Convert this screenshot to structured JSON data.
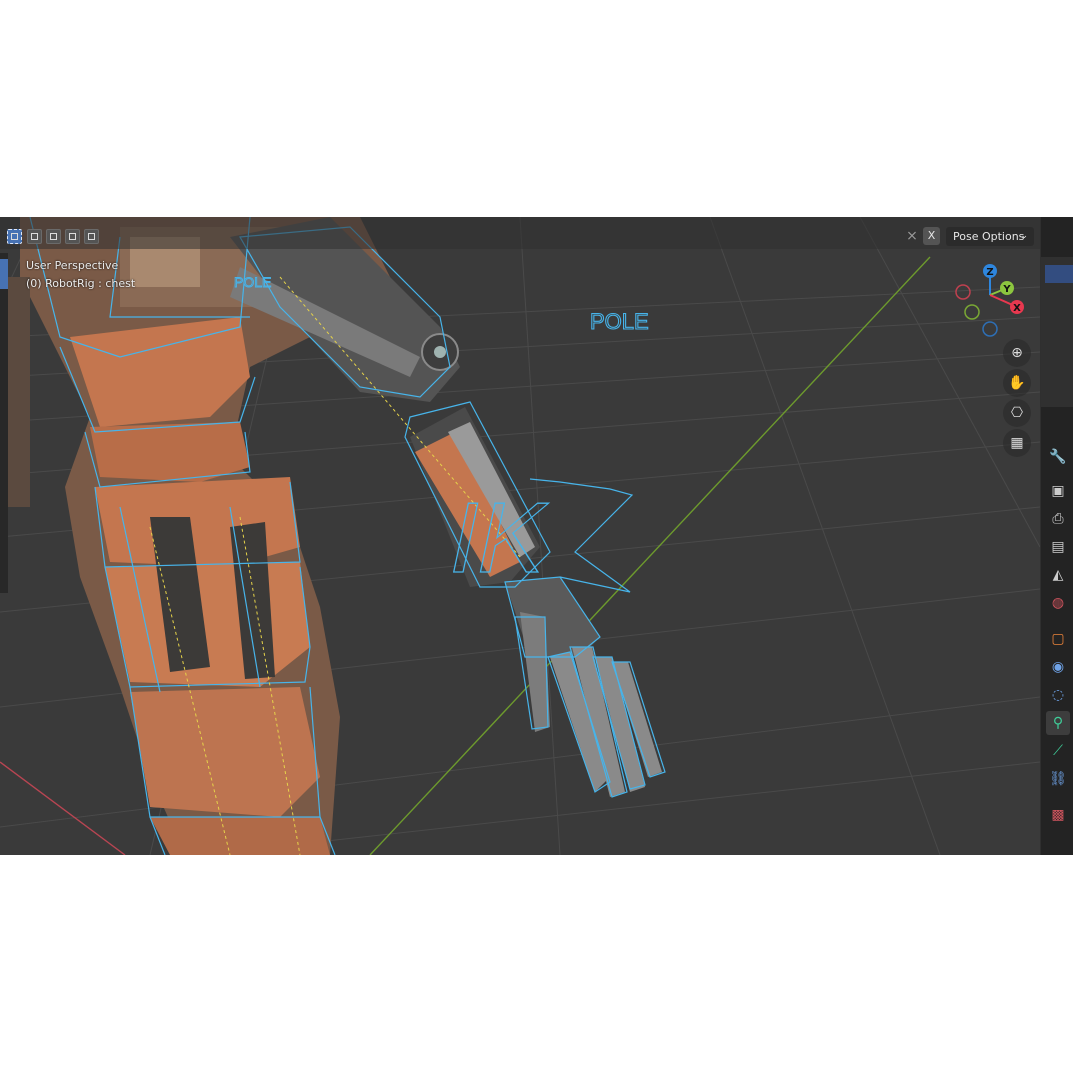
{
  "header": {
    "select_modes": [
      "select-new",
      "select-extend",
      "select-subtract",
      "select-invert",
      "select-intersect"
    ],
    "mirror_icon": "butterfly-icon",
    "mirror_axis": "X",
    "pose_options_label": "Pose Options"
  },
  "viewport": {
    "perspective_label": "User Perspective",
    "active_object": "(0) RobotRig : chest",
    "text_labels": {
      "pole_far": "POLE",
      "pole_near": "POLE",
      "ik": "IK"
    }
  },
  "gizmo": {
    "z_label": "Z",
    "y_label": "Y",
    "x_label": "X",
    "colors": {
      "x": "#e8384f",
      "y": "#8cc63f",
      "z": "#2e86de"
    }
  },
  "nav_buttons": [
    "zoom-icon",
    "hand-pan-icon",
    "camera-icon",
    "grid-view-icon"
  ],
  "properties_tabs": [
    "tool-icon",
    "render-icon",
    "output-icon",
    "view-layer-icon",
    "scene-icon",
    "world-icon",
    "object-icon",
    "modifiers-icon",
    "physics-icon",
    "object-data-armature-icon",
    "bone-icon",
    "bone-constraint-icon",
    "texture-icon"
  ],
  "colors": {
    "accent": "#4772b3",
    "bone_wire": "#47b4ea",
    "robot_orange": "#c4764f",
    "grid_x_axis": "#c24a5a",
    "grid_y_axis": "#6d9a2d"
  }
}
